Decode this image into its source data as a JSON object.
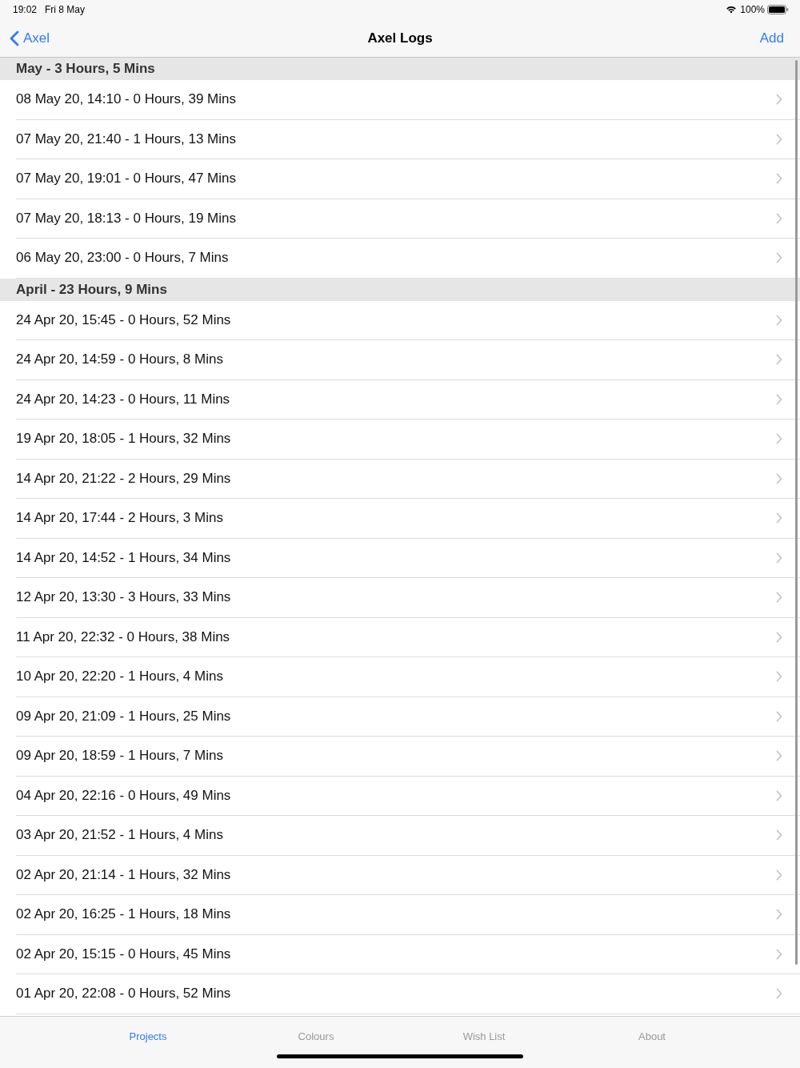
{
  "status_bar": {
    "time": "19:02",
    "date": "Fri 8 May",
    "battery": "100%"
  },
  "nav_bar": {
    "back": "Axel",
    "title": "Axel Logs",
    "action": "Add"
  },
  "sections": [
    {
      "title": "May - 3 Hours, 5 Mins",
      "rows": [
        "08 May 20, 14:10 - 0 Hours, 39 Mins",
        "07 May 20, 21:40 - 1 Hours, 13 Mins",
        "07 May 20, 19:01 - 0 Hours, 47 Mins",
        "07 May 20, 18:13 - 0 Hours, 19 Mins",
        "06 May 20, 23:00 - 0 Hours, 7 Mins"
      ]
    },
    {
      "title": "April - 23 Hours, 9 Mins",
      "rows": [
        "24 Apr 20, 15:45 - 0 Hours, 52 Mins",
        "24 Apr 20, 14:59 - 0 Hours, 8 Mins",
        "24 Apr 20, 14:23 - 0 Hours, 11 Mins",
        "19 Apr 20, 18:05 - 1 Hours, 32 Mins",
        "14 Apr 20, 21:22 - 2 Hours, 29 Mins",
        "14 Apr 20, 17:44 - 2 Hours, 3 Mins",
        "14 Apr 20, 14:52 - 1 Hours, 34 Mins",
        "12 Apr 20, 13:30 - 3 Hours, 33 Mins",
        "11 Apr 20, 22:32 - 0 Hours, 38 Mins",
        "10 Apr 20, 22:20 - 1 Hours, 4 Mins",
        "09 Apr 20, 21:09 - 1 Hours, 25 Mins",
        "09 Apr 20, 18:59 - 1 Hours, 7 Mins",
        "04 Apr 20, 22:16 - 0 Hours, 49 Mins",
        "03 Apr 20, 21:52 - 1 Hours, 4 Mins",
        "02 Apr 20, 21:14 - 1 Hours, 32 Mins",
        "02 Apr 20, 16:25 - 1 Hours, 18 Mins",
        "02 Apr 20, 15:15 - 0 Hours, 45 Mins",
        "01 Apr 20, 22:08 - 0 Hours, 52 Mins"
      ]
    }
  ],
  "tab_bar": {
    "tabs": [
      {
        "label": "Projects",
        "selected": true
      },
      {
        "label": "Colours",
        "selected": false
      },
      {
        "label": "Wish List",
        "selected": false
      },
      {
        "label": "About",
        "selected": false
      }
    ]
  }
}
